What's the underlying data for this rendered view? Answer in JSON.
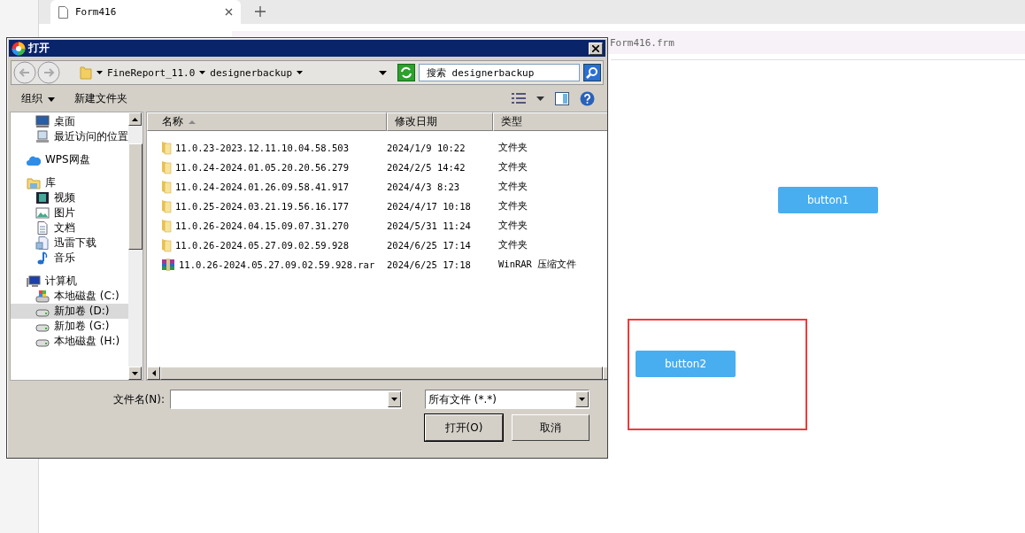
{
  "browser_tab": {
    "title": "Form416"
  },
  "path_bar": {
    "text": "Form416.frm"
  },
  "canvas": {
    "widgets": [
      {
        "label": "button1",
        "selected": false
      },
      {
        "label": "button2",
        "selected": true
      }
    ]
  },
  "dialog": {
    "title": "打开",
    "address": {
      "segments": [
        "FineReport_11.0",
        "designerbackup"
      ]
    },
    "search": {
      "placeholder": "搜索 designerbackup"
    },
    "toolbar": {
      "organize": "组织",
      "new_folder": "新建文件夹"
    },
    "nav": [
      {
        "children": [
          {
            "label": "桌面",
            "kind": "desktop",
            "selected": false
          },
          {
            "label": "最近访问的位置",
            "kind": "recent",
            "selected": false
          }
        ]
      },
      {
        "label": "WPS网盘",
        "kind": "cloud",
        "selected": false
      },
      {
        "label": "库",
        "kind": "library",
        "selected": false,
        "children": [
          {
            "label": "视频",
            "kind": "video",
            "selected": false
          },
          {
            "label": "图片",
            "kind": "image",
            "selected": false
          },
          {
            "label": "文档",
            "kind": "document",
            "selected": false
          },
          {
            "label": "迅雷下载",
            "kind": "download",
            "selected": false
          },
          {
            "label": "音乐",
            "kind": "music",
            "selected": false
          }
        ]
      },
      {
        "label": "计算机",
        "kind": "computer",
        "selected": false,
        "children": [
          {
            "label": "本地磁盘 (C:)",
            "kind": "system",
            "selected": false
          },
          {
            "label": "新加卷 (D:)",
            "kind": "drive",
            "selected": true
          },
          {
            "label": "新加卷 (G:)",
            "kind": "drive",
            "selected": false
          },
          {
            "label": "本地磁盘 (H:)",
            "kind": "drive",
            "selected": false
          }
        ]
      }
    ],
    "columns": [
      {
        "label": "名称",
        "sorted": true
      },
      {
        "label": "修改日期",
        "sorted": false
      },
      {
        "label": "类型",
        "sorted": false
      }
    ],
    "files": [
      {
        "name": "11.0.23-2023.12.11.10.04.58.503",
        "date": "2024/1/9 10:22",
        "type": "文件夹",
        "kind": "folder"
      },
      {
        "name": "11.0.24-2024.01.05.20.20.56.279",
        "date": "2024/2/5 14:42",
        "type": "文件夹",
        "kind": "folder"
      },
      {
        "name": "11.0.24-2024.01.26.09.58.41.917",
        "date": "2024/4/3 8:23",
        "type": "文件夹",
        "kind": "folder"
      },
      {
        "name": "11.0.25-2024.03.21.19.56.16.177",
        "date": "2024/4/17 10:18",
        "type": "文件夹",
        "kind": "folder"
      },
      {
        "name": "11.0.26-2024.04.15.09.07.31.270",
        "date": "2024/5/31 11:24",
        "type": "文件夹",
        "kind": "folder"
      },
      {
        "name": "11.0.26-2024.05.27.09.02.59.928",
        "date": "2024/6/25 17:14",
        "type": "文件夹",
        "kind": "folder"
      },
      {
        "name": "11.0.26-2024.05.27.09.02.59.928.rar",
        "date": "2024/6/25 17:18",
        "type": "WinRAR 压缩文件",
        "kind": "archive"
      }
    ],
    "filename": {
      "label": "文件名(N):"
    },
    "filetype": {
      "value": "所有文件 (*.*)"
    },
    "buttons": [
      {
        "label": "打开(O)",
        "default": true
      },
      {
        "label": "取消",
        "default": false
      }
    ]
  }
}
